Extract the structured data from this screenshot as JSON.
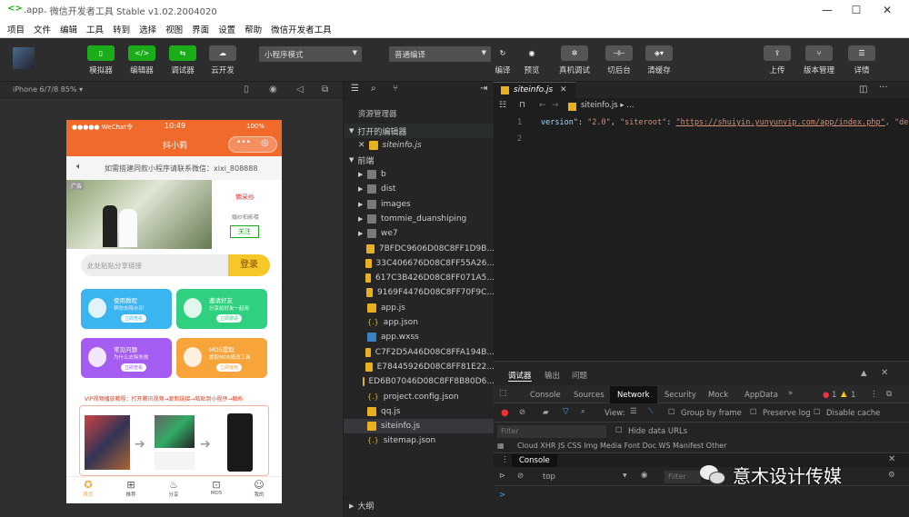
{
  "window": {
    "title_prefix": ".app",
    "title_rest": " - 微信开发者工具 Stable v1.02.2004020",
    "logo": "<>",
    "min_icon": "—",
    "max_icon": "☐",
    "close_icon": "✕"
  },
  "menu": [
    "项目",
    "文件",
    "编辑",
    "工具",
    "转到",
    "选择",
    "视图",
    "界面",
    "设置",
    "帮助",
    "微信开发者工具"
  ],
  "toolbar": {
    "simulator": "模拟器",
    "editor": "编辑器",
    "debugger": "调试器",
    "cloud": "云开发",
    "mode_select": "小程序模式",
    "compile_select": "普通编译",
    "compile": "编译",
    "preview": "预览",
    "real_debug": "真机调试",
    "background": "切后台",
    "clear_cache": "清缓存",
    "upload": "上传",
    "version_mgmt": "版本管理",
    "details": "详情"
  },
  "simulator": {
    "device": "iPhone 6/7/8 85% ▾",
    "status_carrier": "●●●●● WeChat令",
    "status_time": "10:49",
    "status_battery": "100%",
    "nav_title": "抖小莉",
    "notice": "如需搭建同款小程序请联系微信：xixi_808888",
    "ad_badge": "广告",
    "ad_brand": "佛采纱",
    "ad_sub": "婚纱拍影楼",
    "ad_follow": "关注",
    "search_placeholder": "此处粘贴分享链接",
    "login_btn": "登录",
    "cards": [
      {
        "title": "使用教程",
        "sub": "帮你去除水印",
        "btn": "立即查看",
        "color": "#3bb5f0"
      },
      {
        "title": "邀请好友",
        "sub": "分享给好友一起用",
        "btn": "立即邀请",
        "color": "#2fd07f"
      },
      {
        "title": "常见问题",
        "sub": "为什么去除失败",
        "btn": "立即查看",
        "color": "#a55cf0"
      },
      {
        "title": "MD5提取",
        "sub": "提取MD5修改工具",
        "btn": "立即使用",
        "color": "#f7a43b"
      }
    ],
    "vip_text": "VIP视频播放教程：打开腾讯视频→复制链接→粘贴到小程序→解析",
    "tabs": [
      "首页",
      "推荐",
      "分享",
      "MD5",
      "我的"
    ]
  },
  "explorer": {
    "header": "资源管理器",
    "open_editors": "打开的编辑器",
    "open_file": "siteinfo.js",
    "project": "前端",
    "items": [
      {
        "name": "b",
        "type": "folder"
      },
      {
        "name": "dist",
        "type": "folder"
      },
      {
        "name": "images",
        "type": "folder"
      },
      {
        "name": "tommie_duanshiping",
        "type": "folder"
      },
      {
        "name": "we7",
        "type": "folder"
      },
      {
        "name": "7BFDC9606D08C8FF1D9B...",
        "type": "js"
      },
      {
        "name": "33C406676D08C8FF55A26...",
        "type": "js"
      },
      {
        "name": "617C3B426D08C8FF071A5...",
        "type": "js"
      },
      {
        "name": "9169F4476D08C8FF70F9C...",
        "type": "js"
      },
      {
        "name": "app.js",
        "type": "js"
      },
      {
        "name": "app.json",
        "type": "json"
      },
      {
        "name": "app.wxss",
        "type": "wxss"
      },
      {
        "name": "C7F2D5A46D08C8FFA194B...",
        "type": "js"
      },
      {
        "name": "E78445926D08C8FF81E22...",
        "type": "js"
      },
      {
        "name": "ED6B07046D08C8FF8B80D6...",
        "type": "js"
      },
      {
        "name": "project.config.json",
        "type": "json"
      },
      {
        "name": "qq.js",
        "type": "js"
      },
      {
        "name": "siteinfo.js",
        "type": "js"
      },
      {
        "name": "sitemap.json",
        "type": "json"
      }
    ],
    "outline": "大纲"
  },
  "editor": {
    "tab": "siteinfo.js",
    "breadcrumb": "siteinfo.js ▸ ...",
    "line_numbers": [
      "1",
      "2"
    ],
    "code_key1": "version",
    "code_val1": "\"2.0\"",
    "code_key2": "\"siteroot\"",
    "code_url": "\"https://shuiyin.yunyunvip.com/app/index.php\"",
    "code_tail": ", \"desi"
  },
  "devtools": {
    "top_tabs": [
      "调试器",
      "输出",
      "问题"
    ],
    "panel_tabs": [
      "Console",
      "Sources",
      "Network",
      "Security",
      "Mock",
      "AppData"
    ],
    "more": "»",
    "errors": "1",
    "warnings": "1",
    "view_label": "View:",
    "group_by_frame": "Group by frame",
    "preserve_log": "Preserve log",
    "disable_cache": "Disable cache",
    "filter_placeholder": "Filter",
    "hide_data_urls": "Hide data URLs",
    "types": "Cloud  XHR  JS  CSS  Img  Media  Font  Doc  WS  Manifest  Other",
    "console_tab": "Console",
    "context": "top",
    "filter2": "Filter",
    "prompt": ">"
  },
  "watermark": "意木设计传媒"
}
